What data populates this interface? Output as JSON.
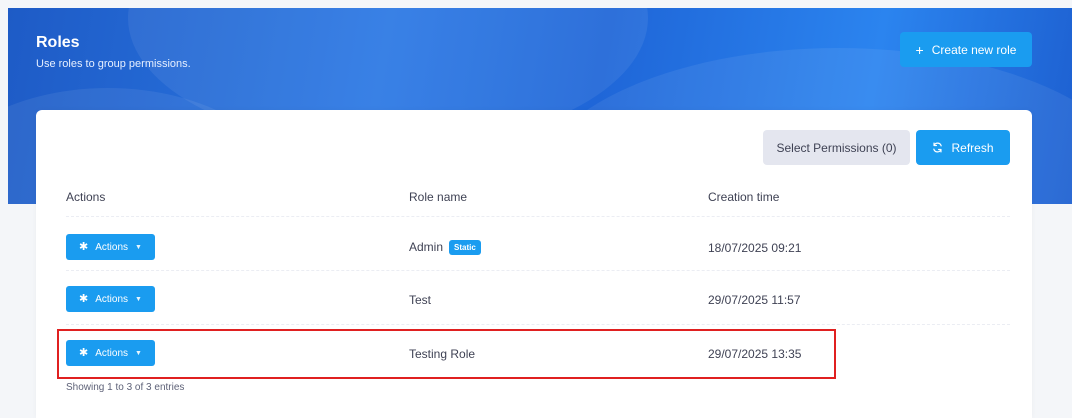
{
  "header": {
    "title": "Roles",
    "subtitle": "Use roles to group permissions.",
    "create_button": {
      "icon": "plus-icon",
      "label": "Create new role"
    }
  },
  "toolbar": {
    "select_permissions_label": "Select Permissions (0)",
    "refresh": {
      "icon": "refresh-icon",
      "label": "Refresh"
    }
  },
  "table": {
    "columns": [
      "Actions",
      "Role name",
      "Creation time"
    ],
    "rows": [
      {
        "actions_label": "Actions",
        "role_name": "Admin",
        "badge": "Static",
        "creation_time": "18/07/2025 09:21"
      },
      {
        "actions_label": "Actions",
        "role_name": "Test",
        "badge": "",
        "creation_time": "29/07/2025 11:57"
      },
      {
        "actions_label": "Actions",
        "role_name": "Testing Role",
        "badge": "",
        "creation_time": "29/07/2025 13:35"
      }
    ],
    "footer": "Showing 1 to 3 of 3 entries"
  },
  "colors": {
    "accent": "#1a9cf0",
    "highlight": "#e02020",
    "hero": "#2a78e4"
  }
}
